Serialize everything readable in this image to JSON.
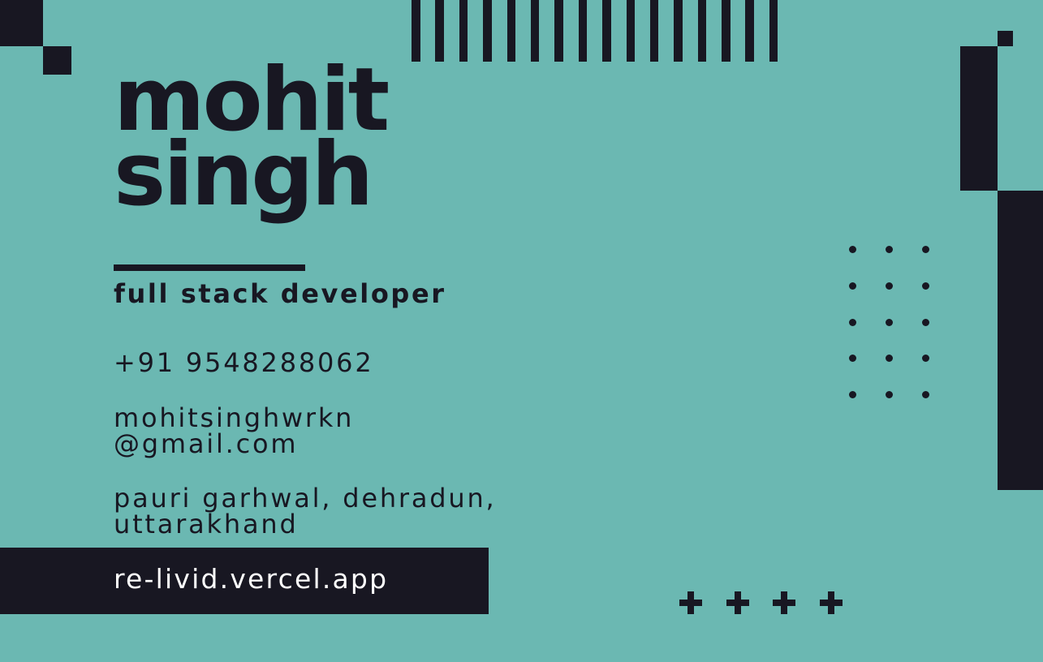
{
  "colors": {
    "background": "#6bb8b2",
    "ink": "#181722",
    "footer_text": "#ffffff"
  },
  "name": {
    "first": "mohit",
    "last": "singh"
  },
  "title": "full stack developer",
  "contact": {
    "phone": "+91 9548288062",
    "email_line1": "mohitsinghwrkn",
    "email_line2": "@gmail.com",
    "address_line1": "pauri garhwal, dehradun,",
    "address_line2": "uttarakhand"
  },
  "website": "re-livid.vercel.app",
  "decor": {
    "stripe_count": 16,
    "dot_rows": 5,
    "dot_cols": 3,
    "plus_count": 4
  }
}
